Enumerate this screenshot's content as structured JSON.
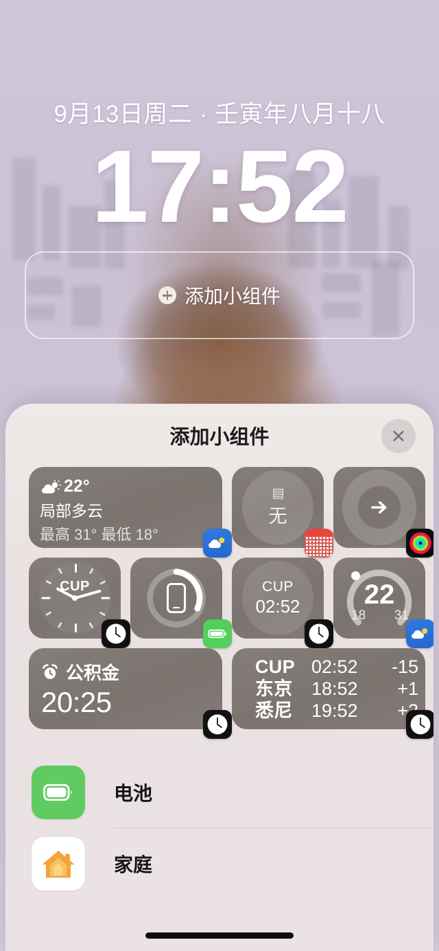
{
  "lockscreen": {
    "date": "9月13日周二 · 壬寅年八月十八",
    "time": "17:52",
    "widget_placeholder": {
      "label": "添加小组件",
      "icon": "plus-circle-icon"
    }
  },
  "sheet": {
    "title": "添加小组件",
    "close_label": "×",
    "close_icon": "close-icon"
  },
  "gallery": {
    "weather_widget": {
      "icon": "partly-cloudy-icon",
      "temperature": "22°",
      "condition": "局部多云",
      "high_low": "最高 31° 最低 18°",
      "app_badge": "weather-app-icon"
    },
    "calendar_widget": {
      "value": "无",
      "app_badge": "calendar-app-icon"
    },
    "activity_widget": {
      "icon": "arrow-right-icon",
      "app_badge": "fitness-app-icon"
    },
    "analog_clock_widget": {
      "city": "CUP",
      "app_badge": "clock-app-icon"
    },
    "battery_widget": {
      "icon": "iphone-icon",
      "app_badge": "battery-app-icon"
    },
    "digital_clock_widget": {
      "city": "CUP",
      "time": "02:52",
      "app_badge": "clock-app-icon"
    },
    "temperature_gauge_widget": {
      "current": "22",
      "low": "18",
      "high": "31",
      "app_badge": "weather-app-icon"
    },
    "alarm_widget": {
      "icon": "alarm-clock-icon",
      "name": "公积金",
      "time": "20:25",
      "app_badge": "clock-app-icon"
    },
    "world_clock_widget": {
      "rows": [
        {
          "city": "CUP",
          "time": "02:52",
          "offset": "-15"
        },
        {
          "city": "东京",
          "time": "18:52",
          "offset": "+1"
        },
        {
          "city": "悉尼",
          "time": "19:52",
          "offset": "+2"
        }
      ],
      "app_badge": "clock-app-icon"
    }
  },
  "app_list": [
    {
      "name": "电池",
      "icon": "battery-app-icon"
    },
    {
      "name": "家庭",
      "icon": "home-app-icon"
    }
  ],
  "colors": {
    "background": "#cdc4d7",
    "sheet": "#e9e1e2",
    "tile": "#7b736e",
    "battery_green": "#5fcb60",
    "home_orange": "#f5a33c",
    "weather_blue": "#2f7ae0"
  }
}
